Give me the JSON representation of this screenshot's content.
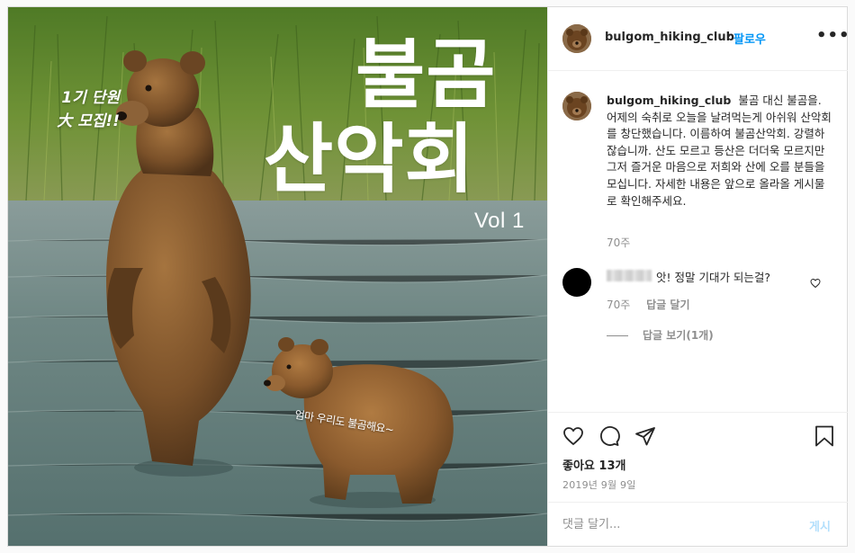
{
  "photo": {
    "title_line1": "불곰",
    "title_line2": "산악회",
    "volume": "Vol 1",
    "recruit_line1": "1기 단원",
    "recruit_line2": "大 모집!!",
    "speech": "엄마 우리도 불곰해요~"
  },
  "header": {
    "username": "bulgom_hiking_club",
    "separator": "•",
    "follow_label": "팔로우",
    "more_icon": "more-options-icon"
  },
  "caption": {
    "username": "bulgom_hiking_club",
    "text": "불곰 대신 불곰을. 어제의 숙취로 오늘을 날려먹는게 아쉬워 산악회를 창단했습니다. 이름하여 불곰산악회. 강렬하잖습니까. 산도 모르고 등산은 더더욱 모르지만 그저 즐거운 마음으로 저희와 산에 오를 분들을 모십니다. 자세한 내용은 앞으로 올라올 게시물로 확인해주세요.",
    "time": "70주"
  },
  "comment": {
    "text": "앗! 정말 기대가 되는걸?",
    "time": "70주",
    "reply_label": "답글 달기",
    "view_replies": "답글 보기(1개)"
  },
  "actions": {
    "icons": [
      "heart-icon",
      "comment-icon",
      "share-icon",
      "bookmark-icon"
    ],
    "likes": "좋아요 13개",
    "date": "2019년 9월 9일"
  },
  "add_comment": {
    "placeholder": "댓글 달기...",
    "post_label": "게시"
  },
  "colors": {
    "accent": "#0095f6",
    "post_disabled": "#b2dffc",
    "secondary_text": "#8e8e8e"
  }
}
